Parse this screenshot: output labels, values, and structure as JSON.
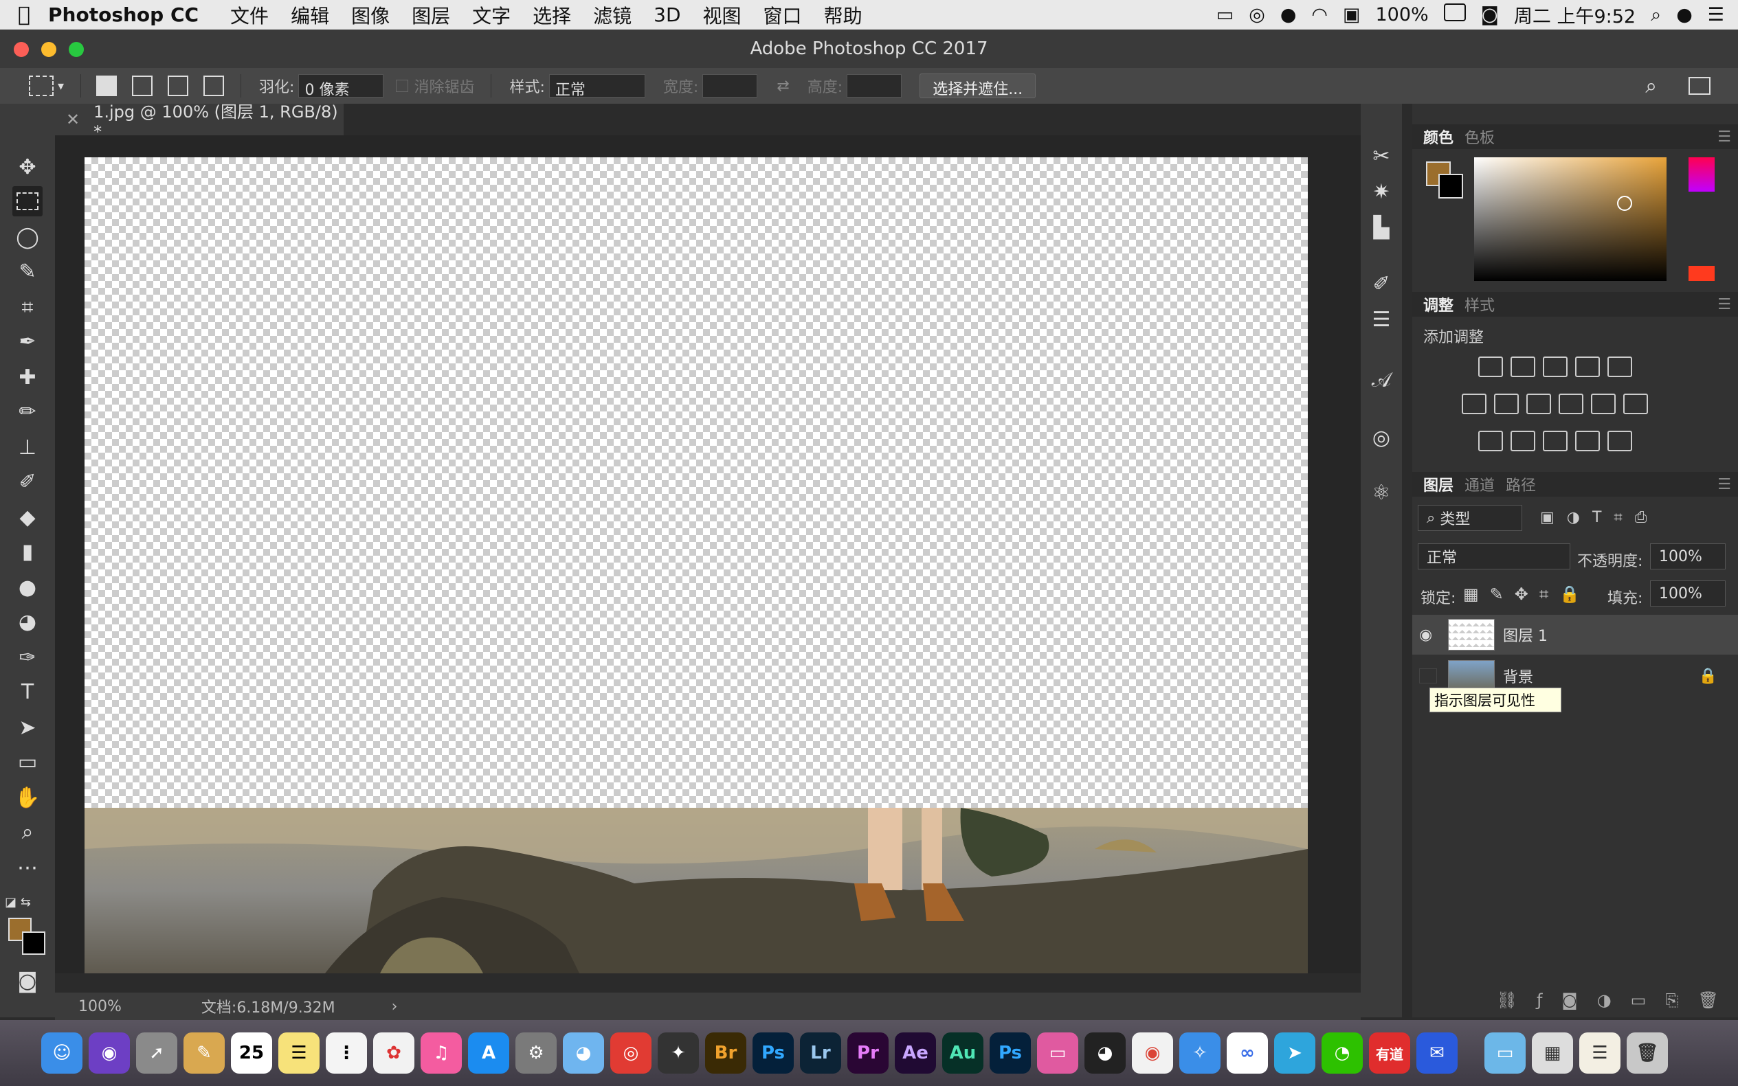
{
  "menubar": {
    "app_name": "Photoshop CC",
    "items": [
      "文件",
      "编辑",
      "图像",
      "图层",
      "文字",
      "选择",
      "滤镜",
      "3D",
      "视图",
      "窗口",
      "帮助"
    ],
    "battery": "100%",
    "clock": "周二 上午9:52"
  },
  "window": {
    "title": "Adobe Photoshop CC 2017"
  },
  "options": {
    "feather_label": "羽化:",
    "feather_value": "0 像素",
    "antialias_label": "消除锯齿",
    "style_label": "样式:",
    "style_value": "正常",
    "width_label": "宽度:",
    "height_label": "高度:",
    "select_mask_button": "选择并遮住..."
  },
  "document": {
    "tab_title": "1.jpg @ 100% (图层 1, RGB/8) *",
    "zoom": "100%",
    "doc_info": "文档:6.18M/9.32M"
  },
  "colors": {
    "foreground": "#9b6e2d",
    "background": "#000000",
    "accent": "#e8a33a"
  },
  "panels": {
    "color_tabs": [
      "颜色",
      "色板"
    ],
    "adjust_tabs": [
      "调整",
      "样式"
    ],
    "add_adjustment": "添加调整",
    "layers_tabs": [
      "图层",
      "通道",
      "路径"
    ],
    "filter_kind": "类型",
    "blend_mode": "正常",
    "opacity_label": "不透明度:",
    "opacity_value": "100%",
    "lock_label": "锁定:",
    "fill_label": "填充:",
    "fill_value": "100%",
    "layers": [
      {
        "name": "图层 1",
        "visible": true,
        "selected": true
      },
      {
        "name": "背景",
        "visible": false,
        "selected": false,
        "locked": true
      }
    ],
    "tooltip": "指示图层可见性"
  },
  "dock": {
    "apps": [
      "Finder",
      "Siri",
      "Launchpad",
      "Preview",
      "Calendar",
      "Notes",
      "Reminders",
      "Photos",
      "iTunes",
      "App Store",
      "System Preferences",
      "QQ Browser",
      "NetEase Music",
      "Final Cut",
      "Br",
      "Ps",
      "Lr",
      "Pr",
      "Ae",
      "Au",
      "Ps",
      "Screen",
      "QQ",
      "Chrome",
      "Safari",
      "Baidu",
      "Telegram",
      "WeChat",
      "有道",
      "Dict",
      "Folder",
      "Screenshots",
      "Docs",
      "Trash"
    ]
  }
}
